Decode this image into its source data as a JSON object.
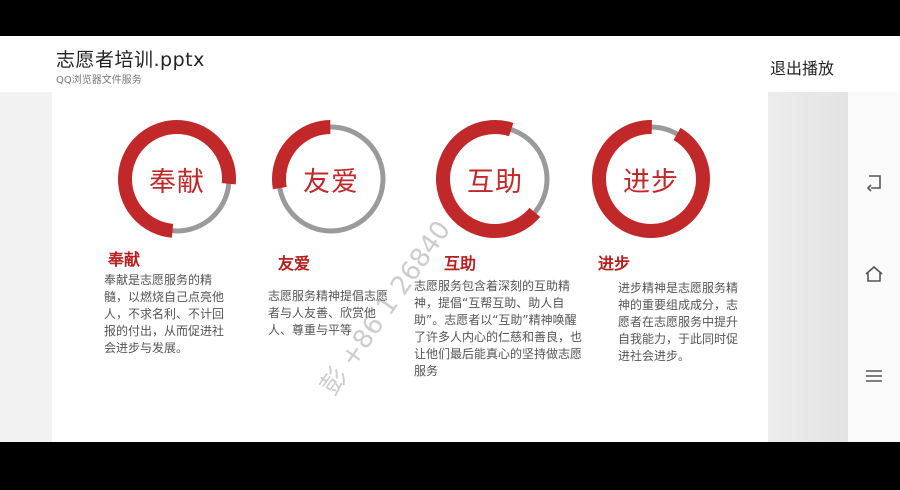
{
  "header": {
    "title": "志愿者培训.pptx",
    "subtitle": "QQ浏览器文件服务",
    "exit_label": "退出播放"
  },
  "nav": {
    "back_icon": "back-icon",
    "home_icon": "home-icon",
    "menu_icon": "menu-icon"
  },
  "slide": {
    "accent_color": "#c0282a",
    "ring_track_color": "#9a9a9a",
    "items": [
      {
        "ring_label": "奉献",
        "heading": "奉献",
        "description": "奉献是志愿服务的精髓，以燃烧自己点亮他人，不求名利、不计回报的付出，从而促进社会进步与发展。"
      },
      {
        "ring_label": "友爱",
        "heading": "友爱",
        "description": "志愿服务精神提倡志愿者与人友善、欣赏他人、尊重与平等"
      },
      {
        "ring_label": "互助",
        "heading": "互助",
        "description": "志愿服务包含着深刻的互助精神，提倡“互帮互助、助人自助”。志愿者以“互助”精神唤醒了许多人内心的仁慈和善良，也让他们最后能真心的坚持做志愿服务"
      },
      {
        "ring_label": "进步",
        "heading": "进步",
        "description": "进步精神是志愿服务精神的重要组成成分，志愿者在志愿服务中提升自我能力，于此同时促进社会进步。"
      }
    ]
  },
  "watermark": "彭 +86 1   26840"
}
